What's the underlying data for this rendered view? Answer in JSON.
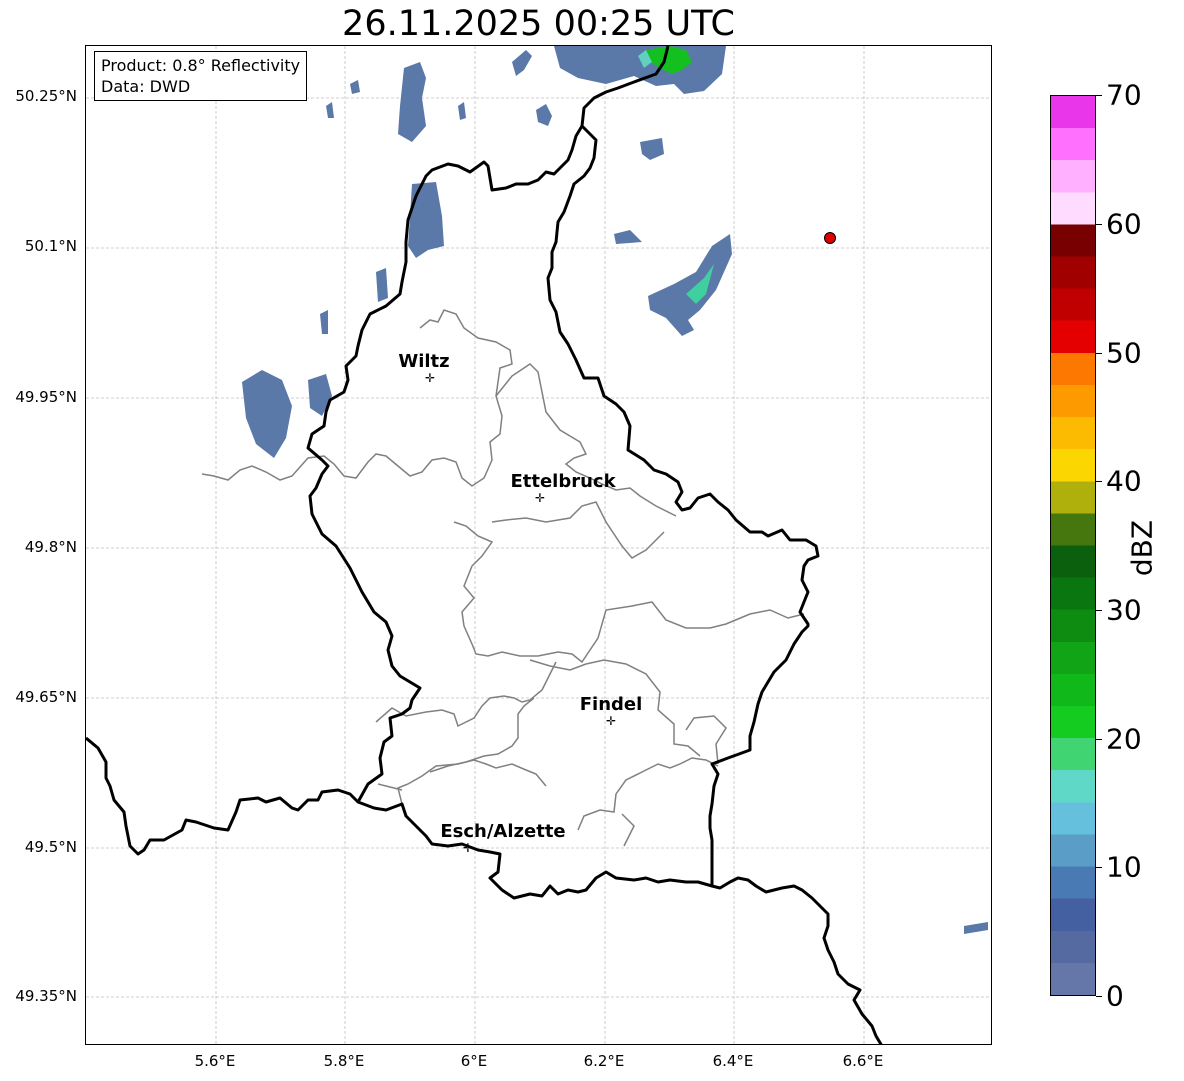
{
  "title": "26.11.2025 00:25 UTC",
  "info": {
    "product": "Product: 0.8° Reflectivity",
    "source": "Data: DWD"
  },
  "axes": {
    "lat_labels": [
      "50.25°N",
      "50.1°N",
      "49.95°N",
      "49.8°N",
      "49.65°N",
      "49.5°N",
      "49.35°N"
    ],
    "lon_labels": [
      "5.6°E",
      "5.8°E",
      "6°E",
      "6.2°E",
      "6.4°E",
      "6.6°E"
    ]
  },
  "cities": [
    {
      "name": "Wiltz"
    },
    {
      "name": "Ettelbruck"
    },
    {
      "name": "Findel"
    },
    {
      "name": "Esch/Alzette"
    }
  ],
  "colorbar": {
    "label": "dBZ",
    "ticks": [
      "0",
      "10",
      "20",
      "30",
      "40",
      "50",
      "60",
      "70"
    ],
    "colors": [
      "#6577a8",
      "#556aa0",
      "#4560a0",
      "#4a7ab4",
      "#5a9ec8",
      "#64c0dc",
      "#60d8c8",
      "#40d472",
      "#14cc20",
      "#10b81a",
      "#10a416",
      "#0e8c12",
      "#0a7610",
      "#0a600c",
      "#46760e",
      "#b0b00c",
      "#fcd600",
      "#fcba00",
      "#fc9a00",
      "#fc7800",
      "#e40000",
      "#c00000",
      "#a00000",
      "#780000",
      "#ffdcff",
      "#ffb0ff",
      "#ff70ff",
      "#ea36ea"
    ]
  },
  "colors": {
    "border_country": "#000000",
    "border_canton": "#808080",
    "grid": "#c0c0c0",
    "radar_marker": "#e00000"
  }
}
